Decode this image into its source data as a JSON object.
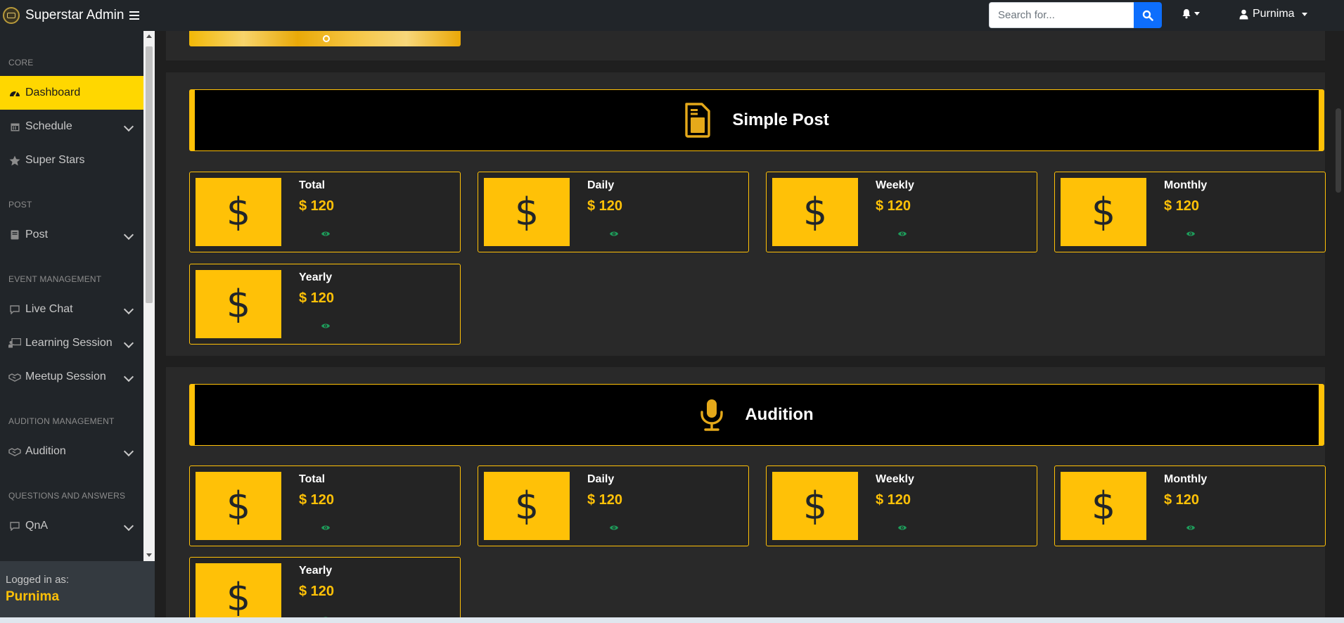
{
  "app": {
    "brand": "Superstar Admin"
  },
  "search": {
    "placeholder": "Search for..."
  },
  "user": {
    "name": "Purnima"
  },
  "sidebar": {
    "headings": [
      "CORE",
      "POST",
      "EVENT MANAGEMENT",
      "AUDITION MANAGEMENT",
      "QUESTIONS AND ANSWERS"
    ],
    "items": [
      {
        "label": "Dashboard",
        "icon": "gauge-icon"
      },
      {
        "label": "Schedule",
        "icon": "calendar-icon"
      },
      {
        "label": "Super Stars",
        "icon": "star-icon"
      },
      {
        "label": "Post",
        "icon": "book-icon"
      },
      {
        "label": "Live Chat",
        "icon": "chat-icon"
      },
      {
        "label": "Learning Session",
        "icon": "chalkboard-icon"
      },
      {
        "label": "Meetup Session",
        "icon": "handshake-icon"
      },
      {
        "label": "Audition",
        "icon": "handshake-icon"
      },
      {
        "label": "QnA",
        "icon": "chat-icon"
      }
    ],
    "footer": {
      "label": "Logged in as:",
      "name": "Purnima"
    }
  },
  "sections": [
    {
      "title": "Simple Post",
      "icon": "document-icon",
      "cards": [
        {
          "title": "Total",
          "value": "$ 120"
        },
        {
          "title": "Daily",
          "value": "$ 120"
        },
        {
          "title": "Weekly",
          "value": "$ 120"
        },
        {
          "title": "Monthly",
          "value": "$ 120"
        },
        {
          "title": "Yearly",
          "value": "$ 120"
        }
      ]
    },
    {
      "title": "Audition",
      "icon": "microphone-icon",
      "cards": [
        {
          "title": "Total",
          "value": "$ 120"
        },
        {
          "title": "Daily",
          "value": "$ 120"
        },
        {
          "title": "Weekly",
          "value": "$ 120"
        },
        {
          "title": "Monthly",
          "value": "$ 120"
        },
        {
          "title": "Yearly",
          "value": "$ 120"
        }
      ]
    }
  ],
  "card_symbol": "$",
  "colors": {
    "accent": "#ffc107",
    "active": "#ffd700",
    "primary": "#0d6efd",
    "eye": "#1e9b5a"
  }
}
